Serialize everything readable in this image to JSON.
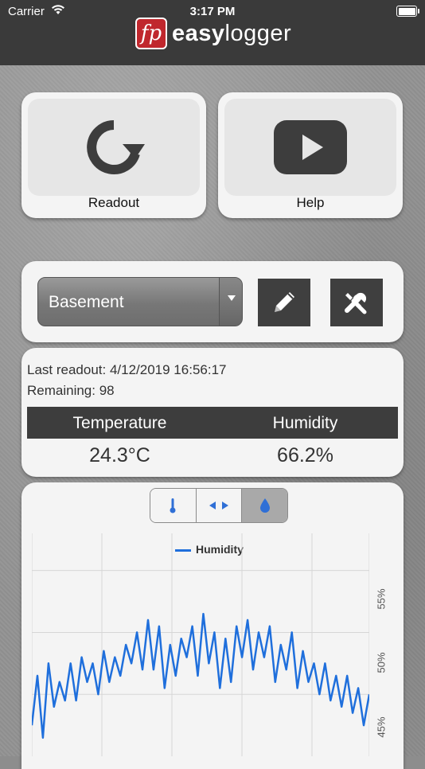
{
  "status_bar": {
    "carrier": "Carrier",
    "time": "3:17 PM"
  },
  "header": {
    "logo_mark": "fp",
    "brand_bold": "easy",
    "brand_light": "logger"
  },
  "actions": {
    "readout": {
      "label": "Readout",
      "icon": "refresh-icon"
    },
    "help": {
      "label": "Help",
      "icon": "play-video-icon"
    }
  },
  "logger_select": {
    "value": "Basement"
  },
  "toolbar": {
    "edit_icon": "pencil-icon",
    "settings_icon": "tools-icon"
  },
  "info": {
    "last_readout": "Last readout: 4/12/2019 16:56:17",
    "remaining": "Remaining: 98",
    "temperature_header": "Temperature",
    "humidity_header": "Humidity",
    "temperature_value": "24.3°C",
    "humidity_value": "66.2%"
  },
  "chart_tabs": [
    {
      "icon": "thermometer-icon",
      "selected": false
    },
    {
      "icon": "both-arrows-icon",
      "selected": false
    },
    {
      "icon": "droplet-icon",
      "selected": true
    }
  ],
  "colors": {
    "header": "#3a3a3a",
    "accent_series": "#1f6fdc",
    "button_dark": "#3f3f3f"
  },
  "chart_data": {
    "type": "line",
    "legend": "top-center",
    "grid": true,
    "series": [
      {
        "name": "Humidity",
        "values": [
          42.5,
          46.5,
          41.5,
          47.5,
          44,
          46,
          44.5,
          47.5,
          44.5,
          48,
          46,
          47.5,
          45,
          48.5,
          46,
          48,
          46.5,
          49,
          47.5,
          50,
          47,
          51,
          47,
          50.5,
          45.5,
          49,
          46.5,
          49.5,
          48,
          50.5,
          46.5,
          51.5,
          47.5,
          50,
          45.5,
          49.5,
          46,
          50.5,
          48,
          51,
          47,
          50,
          48,
          50.5,
          46,
          49,
          47,
          50,
          45.5,
          48.5,
          46,
          47.5,
          45,
          47.5,
          44.5,
          46.5,
          44,
          46.5,
          43.5,
          45.5,
          42.5,
          45
        ]
      }
    ],
    "y_ticks": [
      "45%",
      "50%",
      "55%"
    ],
    "ylim": [
      40,
      58
    ]
  }
}
